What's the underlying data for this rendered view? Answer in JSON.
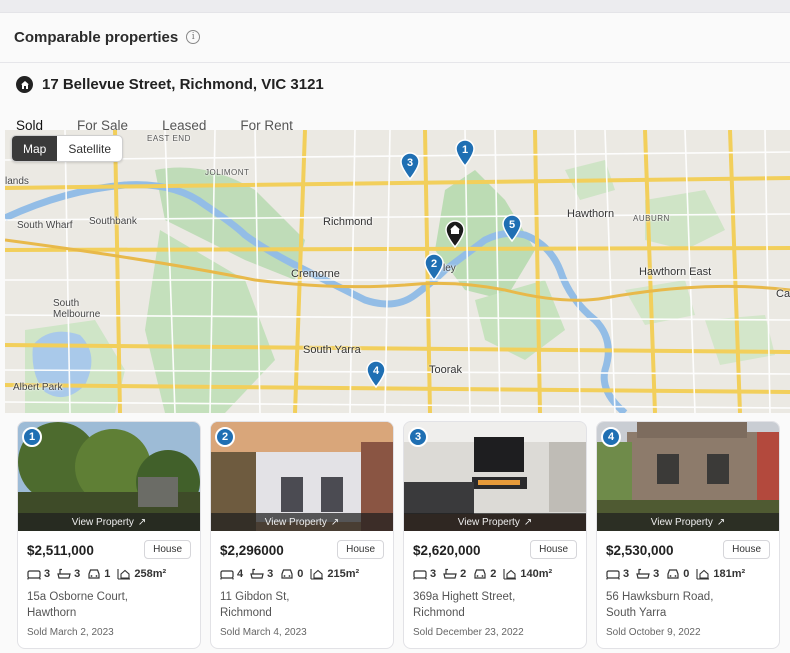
{
  "section": {
    "title": "Comparable properties",
    "info_icon": "info-icon"
  },
  "subject": {
    "icon": "home-pin-icon",
    "address": "17 Bellevue Street, Richmond, VIC 3121"
  },
  "tabs": [
    {
      "label": "Sold",
      "active": true
    },
    {
      "label": "For Sale",
      "active": false
    },
    {
      "label": "Leased",
      "active": false
    },
    {
      "label": "For Rent",
      "active": false
    }
  ],
  "map": {
    "toggle": {
      "map_label": "Map",
      "satellite_label": "Satellite",
      "selected": "Map"
    },
    "labels": {
      "east_end": "EAST END",
      "jolimont": "JOLIMONT",
      "lands": "lands",
      "south_wharf": "South Wharf",
      "southbank": "Southbank",
      "richmond": "Richmond",
      "cremorne": "Cremorne",
      "south_melbourne": "South\nMelbourne",
      "south_yarra": "South Yarra",
      "toorak": "Toorak",
      "albert_park": "Albert Park",
      "hawthorn": "Hawthorn",
      "auburn": "AUBURN",
      "hawthorn_east": "Hawthorn East",
      "ca": "Ca",
      "ley": "ley"
    },
    "pins": [
      "1",
      "2",
      "3",
      "4",
      "5"
    ],
    "pin_color": "#1f6fb3",
    "subject_pin_color": "#1c1c1c"
  },
  "properties": [
    {
      "number": "1",
      "view_label": "View Property",
      "price": "$2,511,000",
      "type": "House",
      "beds": "3",
      "baths": "3",
      "cars": "1",
      "land": "258m²",
      "address_line1": "15a Osborne Court,",
      "address_line2": "Hawthorn",
      "sold": "Sold March 2, 2023"
    },
    {
      "number": "2",
      "view_label": "View Property",
      "price": "$2,296000",
      "type": "House",
      "beds": "4",
      "baths": "3",
      "cars": "0",
      "land": "215m²",
      "address_line1": "11 Gibdon St,",
      "address_line2": "Richmond",
      "sold": "Sold March 4, 2023"
    },
    {
      "number": "3",
      "view_label": "View Property",
      "price": "$2,620,000",
      "type": "House",
      "beds": "3",
      "baths": "2",
      "cars": "2",
      "land": "140m²",
      "address_line1": "369a Highett Street,",
      "address_line2": "Richmond",
      "sold": "Sold December 23, 2022"
    },
    {
      "number": "4",
      "view_label": "View Property",
      "price": "$2,530,000",
      "type": "House",
      "beds": "3",
      "baths": "3",
      "cars": "0",
      "land": "181m²",
      "address_line1": "56 Hawksburn Road,",
      "address_line2": "South Yarra",
      "sold": "Sold October 9, 2022"
    }
  ]
}
